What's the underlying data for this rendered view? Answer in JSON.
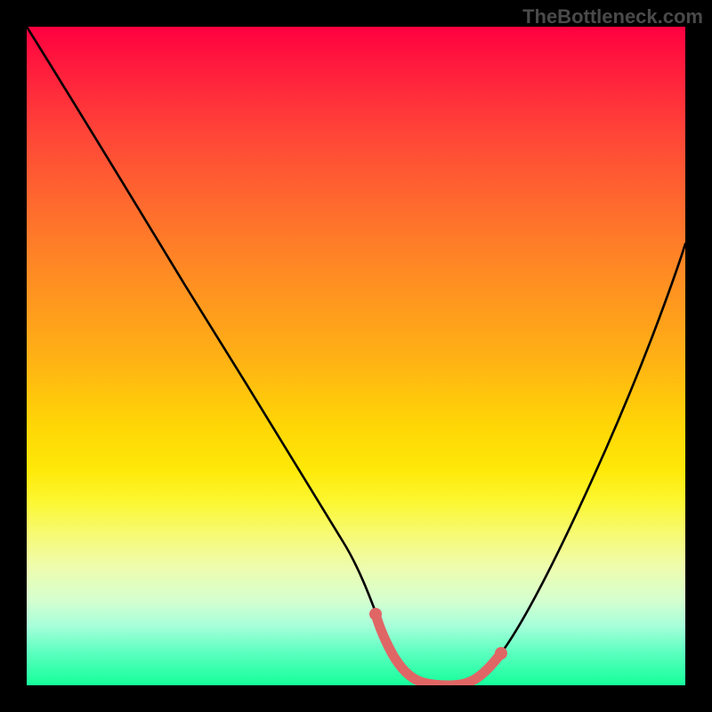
{
  "watermark": "TheBottleneck.com",
  "colors": {
    "frame": "#000000",
    "curve": "#000000",
    "highlight": "#e06666"
  },
  "chart_data": {
    "type": "line",
    "title": "",
    "xlabel": "",
    "ylabel": "",
    "xlim": [
      0,
      100
    ],
    "ylim": [
      0,
      100
    ],
    "series": [
      {
        "name": "bottleneck-curve",
        "x": [
          0,
          8,
          16,
          24,
          32,
          40,
          48,
          53,
          56,
          60,
          64,
          68,
          72,
          80,
          88,
          96,
          100
        ],
        "y": [
          100,
          87,
          74,
          61,
          48,
          35,
          22,
          11,
          4,
          0,
          0,
          0,
          4,
          18,
          36,
          56,
          67
        ]
      },
      {
        "name": "optimal-range-highlight",
        "x": [
          53,
          56,
          60,
          64,
          68,
          72
        ],
        "y": [
          11,
          4,
          0,
          0,
          0,
          4
        ]
      }
    ],
    "annotations": []
  }
}
